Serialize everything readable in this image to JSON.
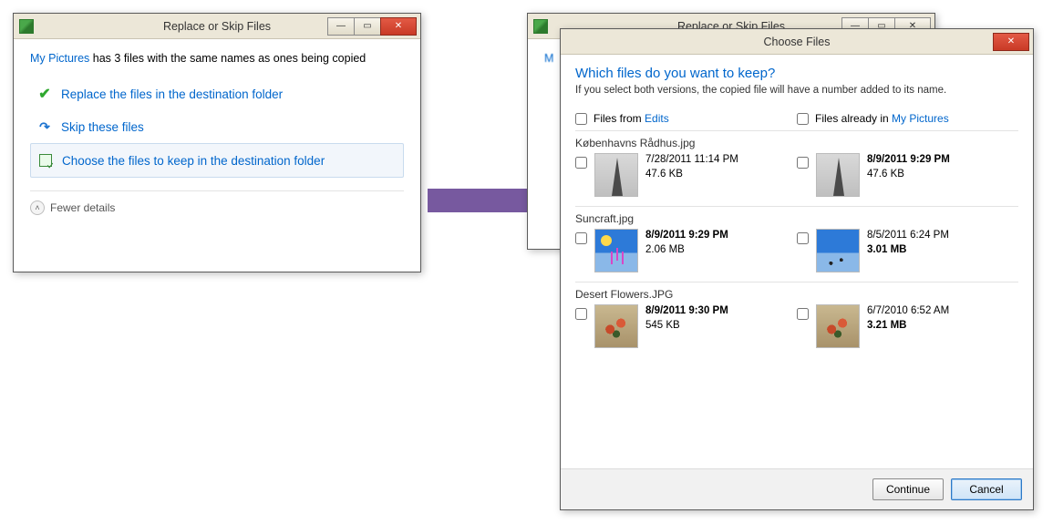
{
  "dialog1": {
    "title": "Replace or Skip Files",
    "folder_link_text": "My Pictures",
    "msg_suffix": " has 3 files with the same names as ones being copied",
    "option_replace": "Replace the files in the destination folder",
    "option_skip": "Skip these files",
    "option_choose": "Choose the files to keep in the destination folder",
    "fewer_details": "Fewer details"
  },
  "bg_dialog": {
    "title": "Replace or Skip Files",
    "folder_initial": "M"
  },
  "choose": {
    "title": "Choose Files",
    "heading": "Which files do you want to keep?",
    "subtext": "If you select both versions, the copied file will have a number added to its name.",
    "col_source_prefix": "Files from ",
    "col_source_link": "Edits",
    "col_dest_prefix": "Files already in ",
    "col_dest_link": "My Pictures",
    "continue_btn": "Continue",
    "cancel_btn": "Cancel",
    "groups": [
      {
        "name": "Københavns Rådhus.jpg",
        "src": {
          "date": "7/28/2011 11:14 PM",
          "date_bold": false,
          "size": "47.6 KB",
          "size_bold": false
        },
        "dest": {
          "date": "8/9/2011 9:29 PM",
          "date_bold": true,
          "size": "47.6 KB",
          "size_bold": false
        }
      },
      {
        "name": "Suncraft.jpg",
        "src": {
          "date": "8/9/2011 9:29 PM",
          "date_bold": true,
          "size": "2.06 MB",
          "size_bold": false
        },
        "dest": {
          "date": "8/5/2011 6:24 PM",
          "date_bold": false,
          "size": "3.01 MB",
          "size_bold": true
        }
      },
      {
        "name": "Desert Flowers.JPG",
        "src": {
          "date": "8/9/2011 9:30 PM",
          "date_bold": true,
          "size": "545 KB",
          "size_bold": false
        },
        "dest": {
          "date": "6/7/2010 6:52 AM",
          "date_bold": false,
          "size": "3.21 MB",
          "size_bold": true
        }
      }
    ]
  }
}
